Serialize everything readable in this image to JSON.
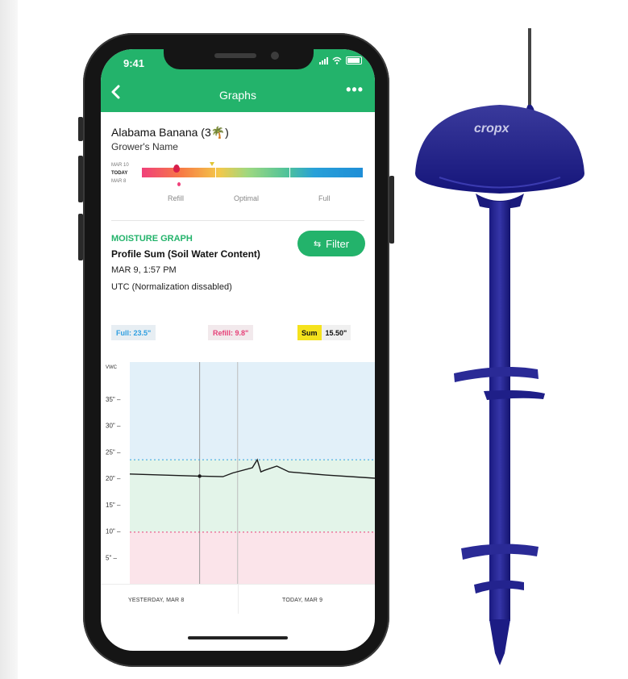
{
  "status_bar": {
    "time": "9:41"
  },
  "header": {
    "back_icon": "chevron-left-icon",
    "title": "Graphs",
    "more_icon": "more-dots-icon",
    "more_label": "•••"
  },
  "farm": {
    "name": "Alabama Banana (3🌴)",
    "grower": "Grower's Name"
  },
  "moisture_bar": {
    "date_labels": [
      "MAR 10",
      "TODAY",
      "MAR 8"
    ],
    "zones": [
      "Refill",
      "Optimal",
      "Full"
    ],
    "colors": {
      "refill": "#f0407a",
      "optimal": "#4ec29a",
      "full": "#1f8ed7"
    }
  },
  "moisture": {
    "section_label": "MOISTURE GRAPH",
    "subtitle": "Profile Sum (Soil Water Content)",
    "date": "MAR 9, 1:57 PM",
    "utc": "UTC (Normalization dissabled)",
    "filter_label": "Filter",
    "filter_icon": "sliders-icon"
  },
  "chips": {
    "full": "Full: 23.5\"",
    "refill": "Refill: 9.8\"",
    "sum_label": "Sum",
    "sum_value": "15.50\""
  },
  "chart_data": {
    "type": "line",
    "ylabel": "VWC",
    "yticks": [
      "35\"",
      "30\"",
      "25\"",
      "20\"",
      "15\"",
      "10\"",
      "5\""
    ],
    "ylim": [
      0,
      42
    ],
    "full_threshold": 23.5,
    "refill_threshold": 9.8,
    "bands": [
      {
        "from": 23.5,
        "to": 42,
        "color": "#e2f0f9"
      },
      {
        "from": 9.8,
        "to": 23.5,
        "color": "#e3f4e9"
      },
      {
        "from": 0,
        "to": 9.8,
        "color": "#fbe4ea"
      }
    ],
    "x": [
      0,
      0.28,
      0.38,
      0.42,
      0.5,
      0.52,
      0.535,
      0.55,
      0.6,
      0.65,
      0.8,
      1.0
    ],
    "series": [
      {
        "values": [
          20.8,
          20.4,
          20.3,
          21.0,
          22.0,
          23.5,
          21.2,
          21.5,
          22.3,
          21.2,
          20.6,
          20.0
        ]
      }
    ],
    "xlabels": [
      "YESTERDAY, MAR 8",
      "TODAY, MAR 9"
    ],
    "grid": false
  },
  "sensor": {
    "brand": "cropx"
  }
}
